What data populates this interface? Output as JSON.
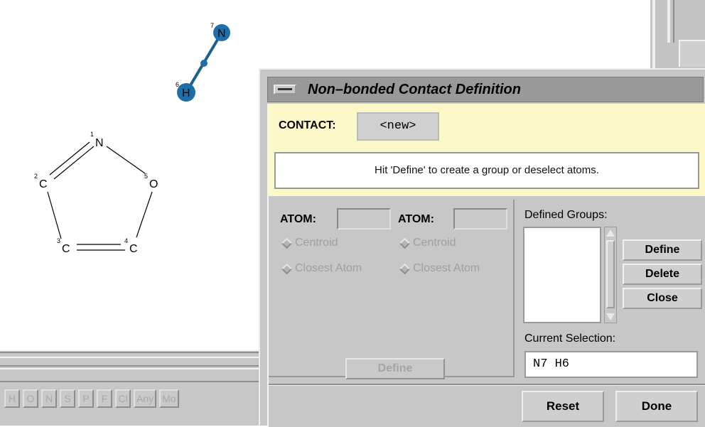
{
  "molecule": {
    "atoms": [
      {
        "symbol": "N",
        "index": "1"
      },
      {
        "symbol": "C",
        "index": "2"
      },
      {
        "symbol": "C",
        "index": "3"
      },
      {
        "symbol": "C",
        "index": "4"
      },
      {
        "symbol": "O",
        "index": "5"
      },
      {
        "symbol": "H",
        "index": "6"
      },
      {
        "symbol": "N",
        "index": "7"
      }
    ],
    "selection_color": "#1e6fa8"
  },
  "toolbar": {
    "elements": [
      "H",
      "O",
      "N",
      "S",
      "P",
      "F",
      "Cl",
      "Any",
      "Mo"
    ]
  },
  "dialog": {
    "title": "Non–bonded Contact Definition",
    "contact_label": "CONTACT:",
    "contact_value": "<new>",
    "message": "Hit 'Define' to create a group or deselect atoms.",
    "atom1_label": "ATOM:",
    "atom2_label": "ATOM:",
    "centroid_label": "Centroid",
    "closest_label": "Closest Atom",
    "atom_define_label": "Define",
    "groups_label": "Defined Groups:",
    "define_label": "Define",
    "delete_label": "Delete",
    "close_label": "Close",
    "current_selection_label": "Current Selection:",
    "current_selection_value": "N7  H6",
    "reset_label": "Reset",
    "done_label": "Done",
    "info_bg": "#fdf8c8"
  }
}
